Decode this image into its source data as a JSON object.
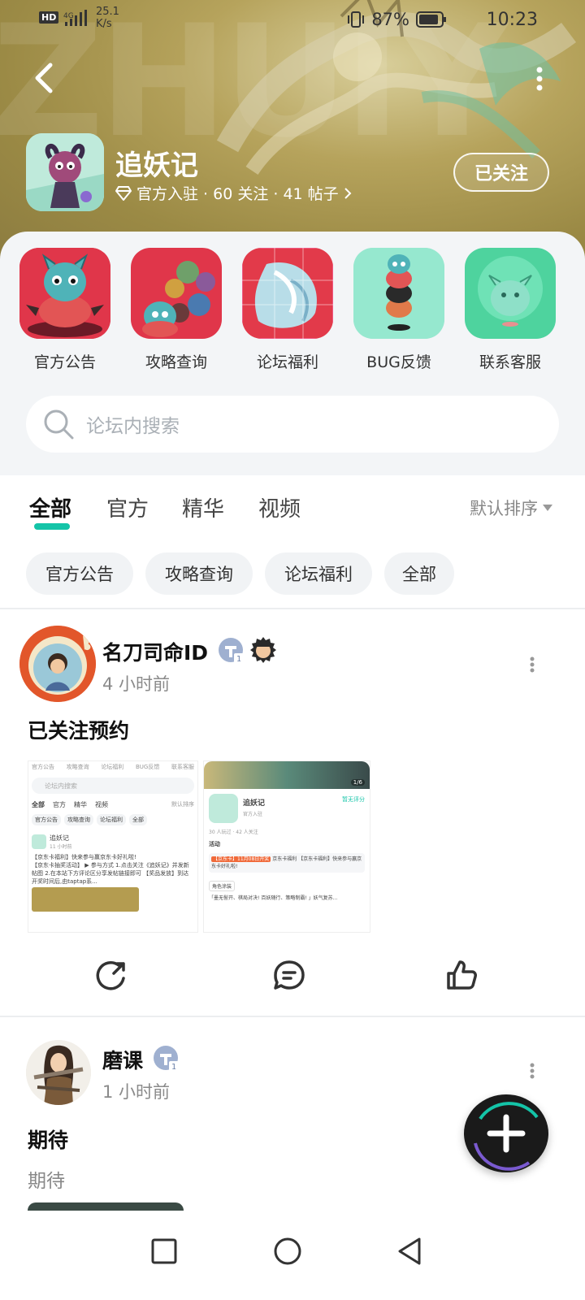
{
  "status_bar": {
    "hd": "HD",
    "network": "4G",
    "speed_value": "25.1",
    "speed_unit": "K/s",
    "battery": "87%",
    "time": "10:23"
  },
  "header": {
    "watermark": "ZHUIY",
    "forum_name": "追妖记",
    "meta": "官方入驻 · 60 关注 · 41 帖子",
    "follow_label": "已关注"
  },
  "shortcuts": [
    {
      "label": "官方公告"
    },
    {
      "label": "攻略查询"
    },
    {
      "label": "论坛福利"
    },
    {
      "label": "BUG反馈"
    },
    {
      "label": "联系客服"
    }
  ],
  "search": {
    "placeholder": "论坛内搜索"
  },
  "tabs": [
    {
      "label": "全部",
      "active": true
    },
    {
      "label": "官方"
    },
    {
      "label": "精华"
    },
    {
      "label": "视频"
    }
  ],
  "sort_label": "默认排序",
  "chips": [
    "官方公告",
    "攻略查询",
    "论坛福利",
    "全部"
  ],
  "posts": [
    {
      "author": "名刀司命ID",
      "time": "4 小时前",
      "title": "已关注预约",
      "thumb1": {
        "nav": [
          "官方公告",
          "攻略查询",
          "论坛福利",
          "BUG反馈",
          "联系客服"
        ],
        "search": "论坛内搜索",
        "tabs": [
          "全部",
          "官方",
          "精华",
          "视频"
        ],
        "sort": "默认排序",
        "chips": [
          "官方公告",
          "攻略查询",
          "论坛福利",
          "全部"
        ],
        "author": "追妖记",
        "time": "11 小时前",
        "line1": "【京东卡福利】快来参与赢京东卡好礼啦!",
        "line2": "【京东卡抽奖活动】 ▶ 参与方式 1.点击关注《追妖记》并发新帖图 2.在本站下方评论区分享发帖链接即可 【奖品发放】到达开奖时间后,由taptap系..."
      },
      "thumb2": {
        "page": "1/6",
        "name": "追妖记",
        "sub": "官方入驻",
        "rating": "暂无评分",
        "stats": "30 人玩过 · 42 人关注",
        "section": "活动",
        "tag": "【京东卡】11月08日开奖",
        "event": "京东卡福利 【京东卡福利】快来参与赢京东卡好礼啦!",
        "tag2": "角色涂装",
        "body": "「墨无髻开、棋局对决! 百妖随行、策略制霸! 」妖气复苏..."
      }
    },
    {
      "author": "磨课",
      "time": "1 小时前",
      "title": "期待",
      "body": "期待"
    }
  ],
  "colors": {
    "accent": "#14c4a8",
    "hero": "#a8954f",
    "panel": "#f3f5f7"
  }
}
